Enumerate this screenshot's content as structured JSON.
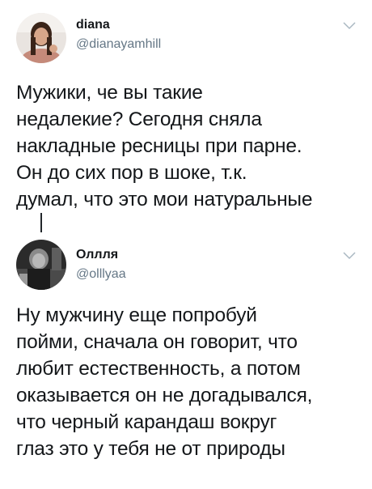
{
  "tweets": [
    {
      "display_name": "diana",
      "handle": "@dianayamhill",
      "avatar_icon": "user-avatar-photo",
      "menu_icon": "chevron-down-icon",
      "text": "Мужики, че вы такие\nнедалекие? Сегодня сняла\nнакладные ресницы при парне.\nОн до сих пор в шоке, т.к.\nдумал, что это мои натуральные"
    },
    {
      "display_name": "Оллля",
      "handle": "@olllyaa",
      "avatar_icon": "user-avatar-photo",
      "menu_icon": "chevron-down-icon",
      "text": "Ну мужчину еще попробуй\nпойми, сначала он говорит, что\nлюбит естественность, а потом\nоказывается он не догадывался,\nчто черный карандаш вокруг\nглаз это у тебя не от природы"
    }
  ]
}
